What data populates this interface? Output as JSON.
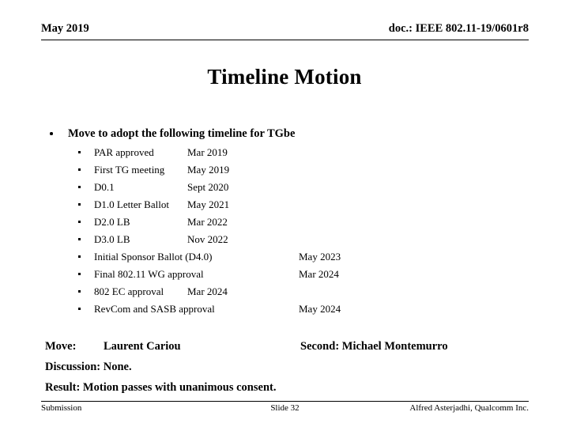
{
  "header": {
    "left": "May 2019",
    "right": "doc.: IEEE 802.11-19/0601r8"
  },
  "title": "Timeline Motion",
  "body": {
    "main_bullet": "Move to adopt the following timeline for TGbe",
    "timeline": [
      {
        "milestone": "PAR approved",
        "date": "Mar 2019",
        "date_column": "near"
      },
      {
        "milestone": "First TG meeting",
        "date": "May 2019",
        "date_column": "near"
      },
      {
        "milestone": "D0.1",
        "date": "Sept 2020",
        "date_column": "near"
      },
      {
        "milestone": "D1.0 Letter Ballot",
        "date": "May 2021",
        "date_column": "near"
      },
      {
        "milestone": "D2.0 LB",
        "date": "Mar 2022",
        "date_column": "near"
      },
      {
        "milestone": "D3.0 LB",
        "date": "Nov 2022",
        "date_column": "near"
      },
      {
        "milestone": "Initial Sponsor Ballot (D4.0)",
        "date": "May 2023",
        "date_column": "far"
      },
      {
        "milestone": "Final 802.11 WG approval",
        "date": "Mar 2024",
        "date_column": "far"
      },
      {
        "milestone": "802 EC approval",
        "date": "Mar 2024",
        "date_column": "near"
      },
      {
        "milestone": "RevCom and SASB approval",
        "date": "May 2024",
        "date_column": "far"
      }
    ]
  },
  "motion": {
    "move_label": "Move:",
    "move_name": "Laurent Cariou",
    "second": "Second: Michael Montemurro",
    "discussion": "Discussion: None.",
    "result": "Result: Motion passes with unanimous consent."
  },
  "footer": {
    "left": "Submission",
    "center": "Slide 32",
    "right": "Alfred Asterjadhi, Qualcomm Inc."
  }
}
